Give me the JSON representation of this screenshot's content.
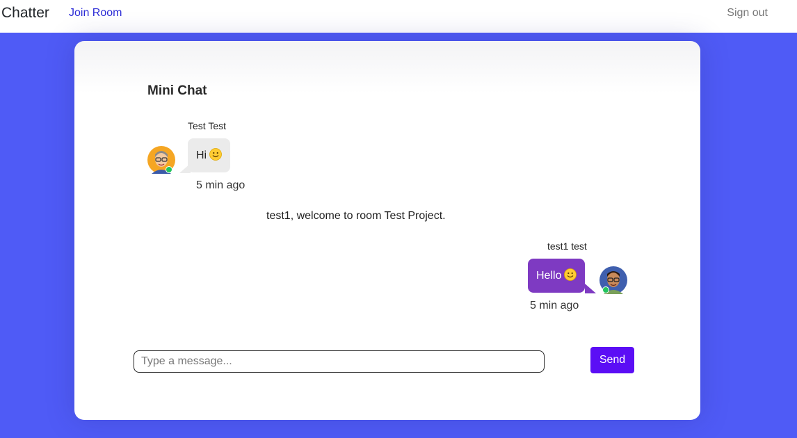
{
  "navbar": {
    "brand": "Chatter",
    "join_room": "Join Room",
    "sign_out": "Sign out"
  },
  "chat": {
    "title": "Mini Chat",
    "messages": [
      {
        "sender": "Test Test",
        "text": "Hi",
        "emoji": "smiley-icon",
        "time": "5 min ago",
        "direction": "incoming",
        "status": "online"
      },
      {
        "sender": "test1 test",
        "text": "Hello",
        "emoji": "smiley-icon",
        "time": "5 min ago",
        "direction": "outgoing",
        "status": "online"
      }
    ],
    "system_message": "test1, welcome to room Test Project."
  },
  "composer": {
    "placeholder": "Type a message...",
    "value": "",
    "send_label": "Send"
  },
  "colors": {
    "background": "#4f5bf6",
    "incoming_bubble": "#ebebeb",
    "outgoing_bubble": "#7e3ac2",
    "send_button": "#5b0ef5",
    "online": "#22c55e",
    "link": "#2b2bd6"
  }
}
